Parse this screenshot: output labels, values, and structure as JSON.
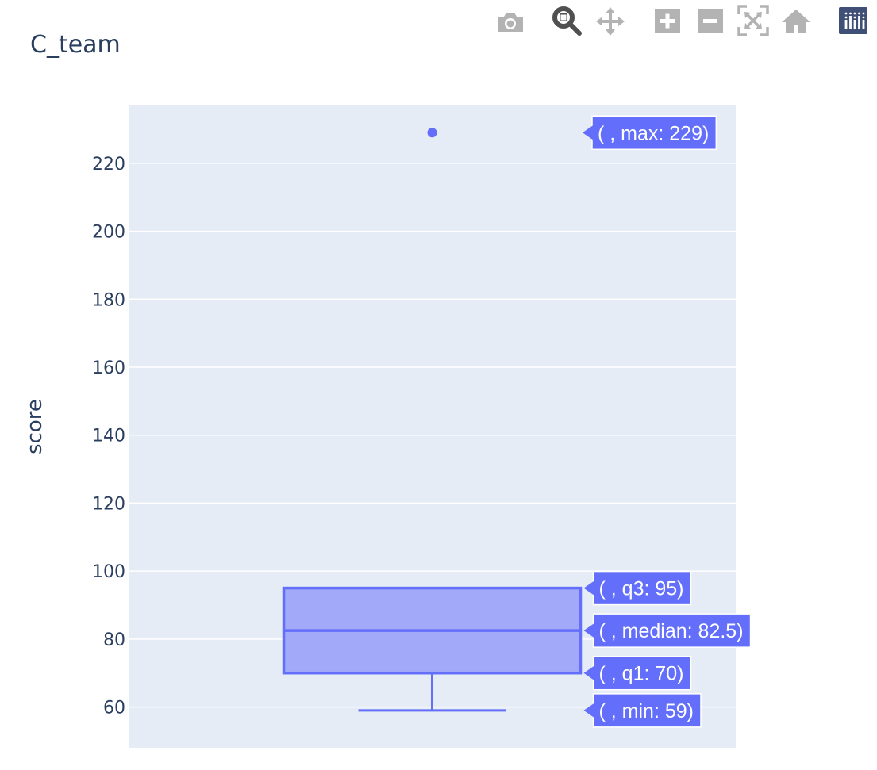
{
  "chart_data": {
    "type": "box",
    "title": "C_team",
    "xlabel": "",
    "ylabel": "score",
    "ylim": [
      48,
      237
    ],
    "yticks": [
      60,
      80,
      100,
      120,
      140,
      160,
      180,
      200,
      220
    ],
    "grid": true,
    "series": [
      {
        "min": 59,
        "q1": 70,
        "median": 82.5,
        "q3": 95,
        "max": 229,
        "upper_fence": 95,
        "outliers": [
          229
        ]
      }
    ],
    "hover_labels": [
      {
        "key": "max",
        "text": "( , max: 229)",
        "value": 229
      },
      {
        "key": "q3",
        "text": "( , q3: 95)",
        "value": 95
      },
      {
        "key": "median",
        "text": "( , median: 82.5)",
        "value": 82.5
      },
      {
        "key": "q1",
        "text": "( , q1: 70)",
        "value": 70
      },
      {
        "key": "min",
        "text": "( , min: 59)",
        "value": 59
      }
    ]
  },
  "colors": {
    "plot_bg": "#e5ecf6",
    "grid": "#ffffff",
    "trace": "#636efa",
    "box_fill": "#a2a9f8",
    "text": "#2a3f5f",
    "modebar_icon": "#b3b3b3",
    "modebar_active": "#505050",
    "logo_bg": "#3f4f75"
  },
  "modebar": [
    {
      "name": "camera-icon",
      "title": "Download plot as a png"
    },
    {
      "name": "zoom-icon",
      "title": "Zoom",
      "active": true
    },
    {
      "name": "pan-icon",
      "title": "Pan"
    },
    {
      "name": "zoom-in-icon",
      "title": "Zoom in"
    },
    {
      "name": "zoom-out-icon",
      "title": "Zoom out"
    },
    {
      "name": "autoscale-icon",
      "title": "Autoscale"
    },
    {
      "name": "reset-axes-icon",
      "title": "Reset axes"
    },
    {
      "name": "plotly-logo-icon",
      "title": "Produced with Plotly"
    }
  ]
}
